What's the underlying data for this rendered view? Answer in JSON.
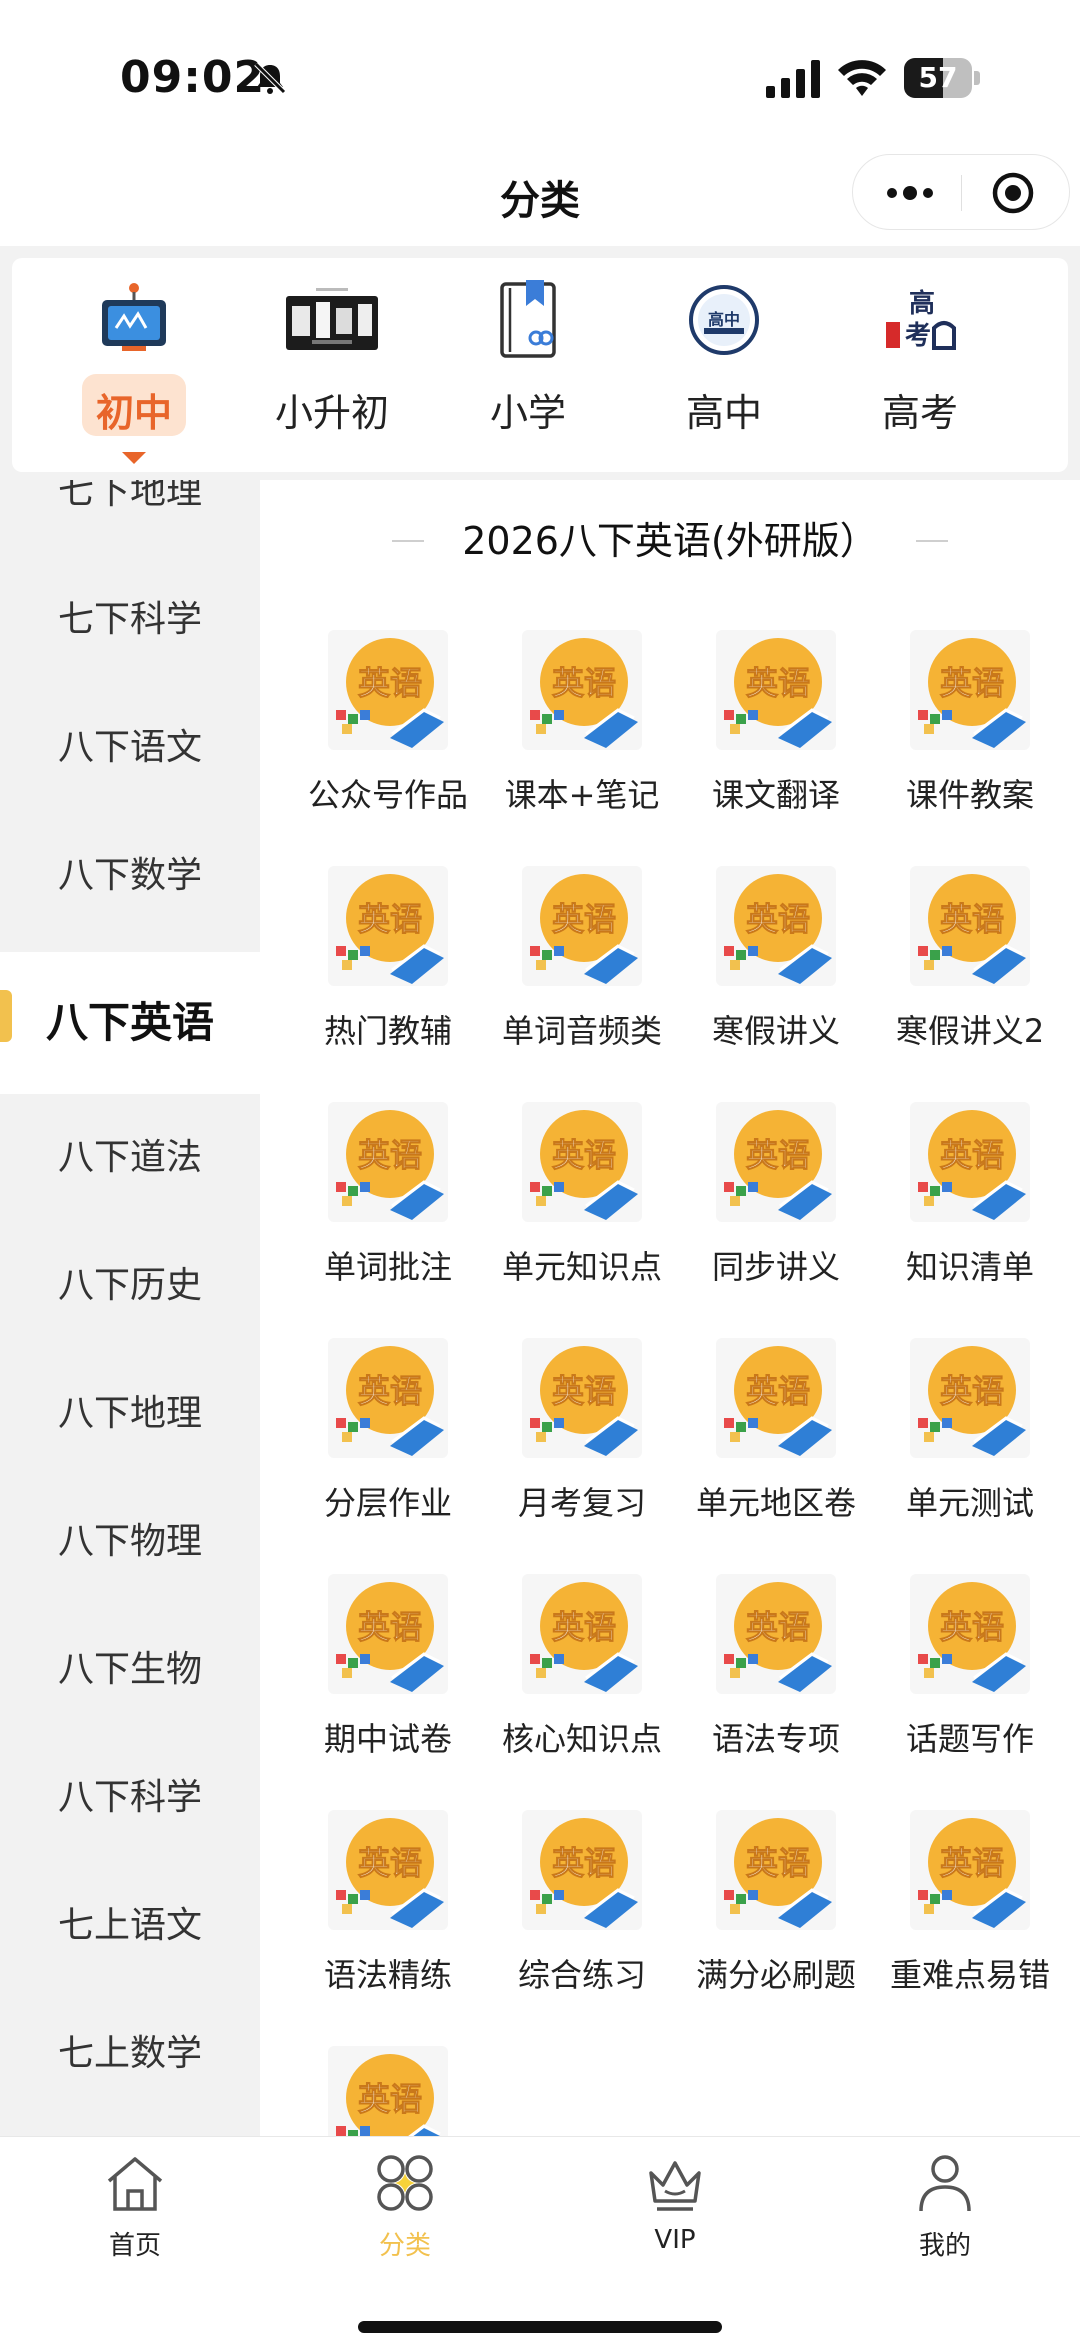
{
  "status_bar": {
    "time": "09:02",
    "battery": "57",
    "battery_level": 0.57
  },
  "nav": {
    "title": "分类"
  },
  "levels": [
    {
      "label": "初中",
      "active": true
    },
    {
      "label": "小升初",
      "active": false
    },
    {
      "label": "小学",
      "active": false
    },
    {
      "label": "高中",
      "active": false
    },
    {
      "label": "高考",
      "active": false
    }
  ],
  "sidebar": {
    "items": [
      {
        "label": "七下地理"
      },
      {
        "label": "七下科学"
      },
      {
        "label": "八下语文"
      },
      {
        "label": "八下数学"
      },
      {
        "label": "八下英语",
        "active": true
      },
      {
        "label": "八下道法"
      },
      {
        "label": "八下历史"
      },
      {
        "label": "八下地理"
      },
      {
        "label": "八下物理"
      },
      {
        "label": "八下生物"
      },
      {
        "label": "八下科学"
      },
      {
        "label": "七上语文"
      },
      {
        "label": "七上数学"
      }
    ]
  },
  "content": {
    "section_title": "2026八下英语(外研版）",
    "icon_text": "英语",
    "items": [
      {
        "label": "公众号作品"
      },
      {
        "label": "课本+笔记"
      },
      {
        "label": "课文翻译"
      },
      {
        "label": "课件教案"
      },
      {
        "label": "热门教辅"
      },
      {
        "label": "单词音频类"
      },
      {
        "label": "寒假讲义"
      },
      {
        "label": "寒假讲义2"
      },
      {
        "label": "单词批注"
      },
      {
        "label": "单元知识点"
      },
      {
        "label": "同步讲义"
      },
      {
        "label": "知识清单"
      },
      {
        "label": "分层作业"
      },
      {
        "label": "月考复习"
      },
      {
        "label": "单元地区卷"
      },
      {
        "label": "单元测试"
      },
      {
        "label": "期中试卷"
      },
      {
        "label": "核心知识点"
      },
      {
        "label": "语法专项"
      },
      {
        "label": "话题写作"
      },
      {
        "label": "语法精练"
      },
      {
        "label": "综合练习"
      },
      {
        "label": "满分必刷题"
      },
      {
        "label": "重难点易错"
      },
      {
        "label": ""
      }
    ]
  },
  "tabbar": {
    "tabs": [
      {
        "label": "首页",
        "icon": "home-icon"
      },
      {
        "label": "分类",
        "icon": "category-icon",
        "active": true
      },
      {
        "label": "VIP",
        "icon": "crown-icon"
      },
      {
        "label": "我的",
        "icon": "user-icon"
      }
    ]
  },
  "colors": {
    "accent": "#f2c14e",
    "level_active": "#e8652a",
    "icon_orange": "#f5b335"
  }
}
